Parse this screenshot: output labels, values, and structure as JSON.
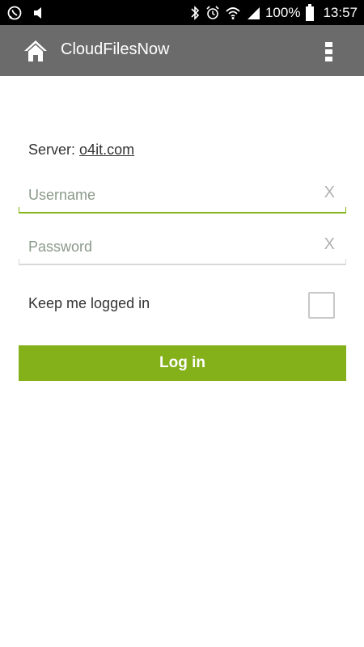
{
  "status_bar": {
    "battery": "100%",
    "time": "13:57",
    "icons": [
      "whatsapp-icon",
      "volume-icon",
      "bluetooth-icon",
      "alarm-icon",
      "wifi-icon",
      "signal-icon",
      "battery-icon"
    ]
  },
  "app_bar": {
    "title": "CloudFilesNow",
    "home_icon": "home-icon",
    "menu_icon": "overflow-menu-icon",
    "background": "#6b6b6b"
  },
  "form": {
    "server_label": "Server:",
    "server_value": "o4it.com",
    "username": {
      "placeholder": "Username",
      "value": "",
      "clear_label": "X"
    },
    "password": {
      "placeholder": "Password",
      "value": "",
      "clear_label": "X"
    },
    "keep_logged_in_label": "Keep me logged in",
    "keep_logged_in_checked": false,
    "login_button": "Log in"
  },
  "colors": {
    "accent": "#84b01a",
    "status_bar": "#000000"
  }
}
